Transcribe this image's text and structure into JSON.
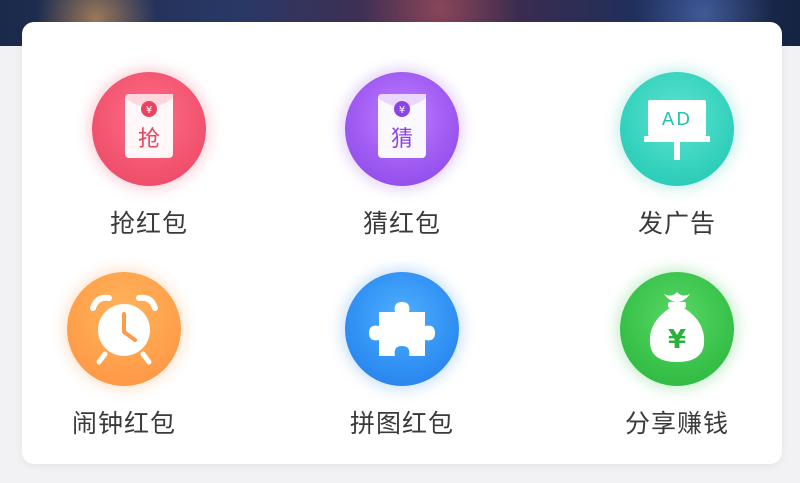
{
  "grid": {
    "items": [
      {
        "label": "抢红包",
        "icon": "grab-red-packet-icon",
        "envelope_char": "抢",
        "yuan": "¥",
        "color": "#f2546f"
      },
      {
        "label": "猜红包",
        "icon": "guess-red-packet-icon",
        "envelope_char": "猜",
        "yuan": "¥",
        "color": "#9c58f0"
      },
      {
        "label": "发广告",
        "icon": "ad-billboard-icon",
        "board_text": "AD",
        "color": "#34d2bd"
      },
      {
        "label": "闹钟红包",
        "icon": "alarm-clock-icon",
        "color": "#ffa14c"
      },
      {
        "label": "拼图红包",
        "icon": "puzzle-piece-icon",
        "color": "#2f8ff3"
      },
      {
        "label": "分享赚钱",
        "icon": "money-bag-icon",
        "yuan": "¥",
        "color": "#38c24a"
      }
    ]
  }
}
